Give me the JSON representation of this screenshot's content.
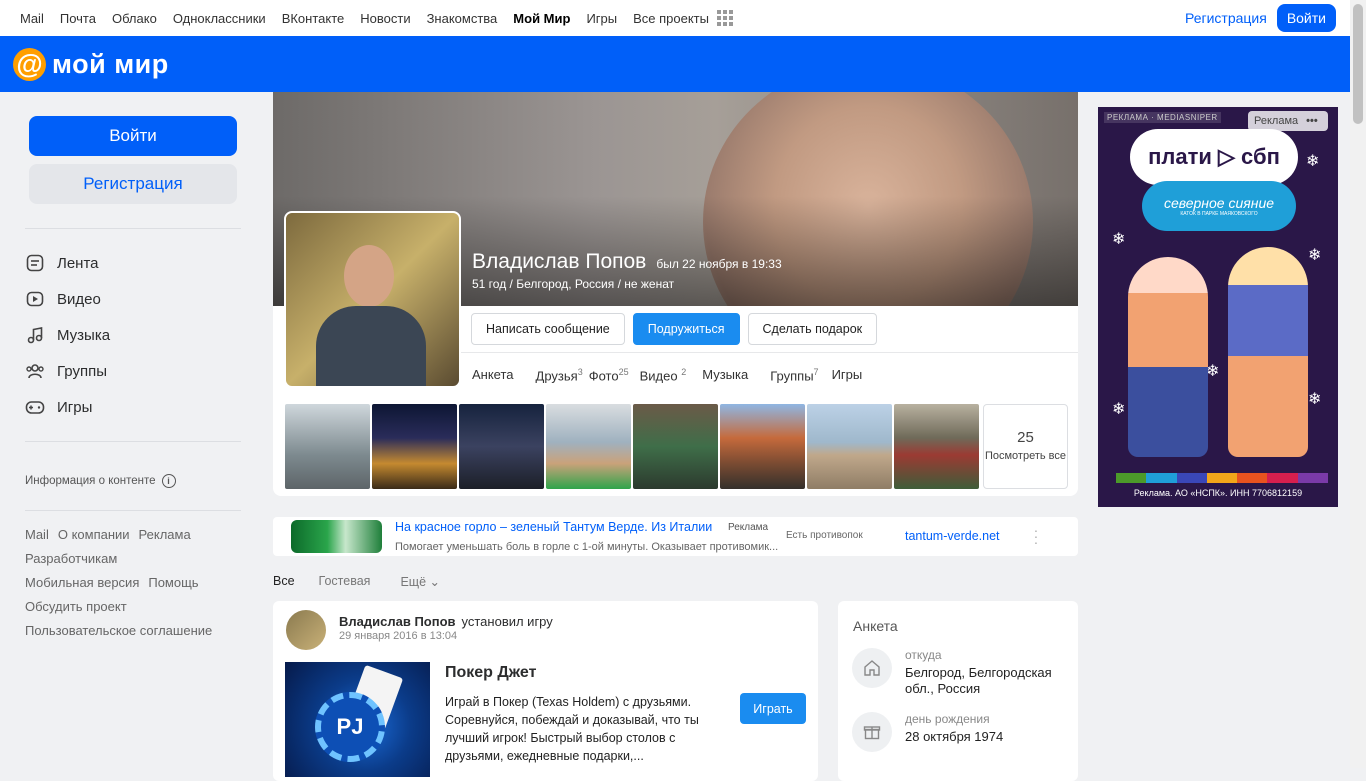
{
  "topnav": {
    "items": [
      "Mail",
      "Почта",
      "Облако",
      "Одноклассники",
      "ВКонтакте",
      "Новости",
      "Знакомства",
      "Мой Мир",
      "Игры",
      "Все проекты"
    ],
    "active": "Мой Мир",
    "register": "Регистрация",
    "login": "Войти"
  },
  "header": {
    "logo_symbol": "@",
    "logo_text": "мой мир",
    "brand_color": "#005ff9",
    "logo_color": "#ff9e00"
  },
  "sidebar": {
    "login": "Войти",
    "register": "Регистрация",
    "nav": [
      {
        "label": "Лента",
        "icon": "feed-icon"
      },
      {
        "label": "Видео",
        "icon": "video-icon"
      },
      {
        "label": "Музыка",
        "icon": "music-icon"
      },
      {
        "label": "Группы",
        "icon": "groups-icon"
      },
      {
        "label": "Игры",
        "icon": "gamepad-icon"
      }
    ],
    "content_info": "Информация о контенте",
    "footer": [
      "Mail",
      "О компании",
      "Реклама",
      "Разработчикам",
      "Мобильная версия",
      "Помощь",
      "Обсудить проект",
      "Пользовательское соглашение"
    ]
  },
  "profile": {
    "name": "Владислав Попов",
    "last_seen": "был 22 ноября в 19:33",
    "meta": "51 год / Белгород, Россия / не женат",
    "buttons": {
      "message": "Написать сообщение",
      "friend": "Подружиться",
      "gift": "Сделать подарок"
    },
    "tabs": [
      {
        "label": "Анкета",
        "count": ""
      },
      {
        "label": "Друзья",
        "count": "3"
      },
      {
        "label": "Фото",
        "count": "25"
      },
      {
        "label": "Видео",
        "count": "2"
      },
      {
        "label": "Музыка",
        "count": ""
      },
      {
        "label": "Группы",
        "count": "7"
      },
      {
        "label": "Игры",
        "count": ""
      }
    ],
    "photos_count": "25",
    "photos_more": "Посмотреть все"
  },
  "ad_strip": {
    "title": "На красное горло – зеленый Тантум Верде. Из Италии",
    "label": "Реклама",
    "text": "Помогает уменьшать боль в горле с 1-ой минуты. Оказывает противомик...",
    "text2": "Есть противопок",
    "domain": "tantum-verde.net"
  },
  "feed_tabs": {
    "all": "Все",
    "guest": "Гостевая",
    "more": "Ещё"
  },
  "post": {
    "user": "Владислав Попов",
    "action": "установил игру",
    "date": "29 января 2016 в 13:04",
    "game_title": "Покер Джет",
    "game_desc": "Играй в Покер (Texas Holdem) с друзьями. Соревнуйся, побеждай и доказывай, что ты лучший игрок! Быстрый выбор столов с друзьями, ежедневные подарки,...",
    "play": "Играть",
    "chip_text": "PJ"
  },
  "anketa": {
    "title": "Анкета",
    "from_label": "откуда",
    "from_value": "Белгород, Белгородская обл., Россия",
    "bday_label": "день рождения",
    "bday_value": "28 октября 1974"
  },
  "banner": {
    "top": "РЕКЛАМА · MEDIASNIPER",
    "label": "Реклама",
    "pill": "плати ▷ сбп",
    "pill2": "северное сияние",
    "pill2_sub": "КАТОК В ПАРКЕ МАЯКОВСКОГО",
    "footer": "Реклама. АО «НСПК». ИНН 7706812159"
  }
}
